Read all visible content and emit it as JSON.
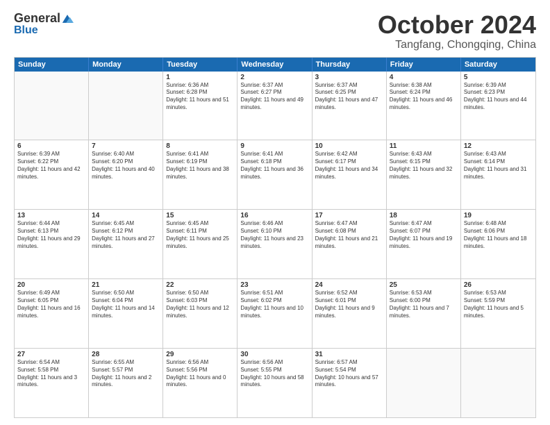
{
  "header": {
    "logo_general": "General",
    "logo_blue": "Blue",
    "month_title": "October 2024",
    "location": "Tangfang, Chongqing, China"
  },
  "weekdays": [
    "Sunday",
    "Monday",
    "Tuesday",
    "Wednesday",
    "Thursday",
    "Friday",
    "Saturday"
  ],
  "rows": [
    [
      {
        "day": "",
        "text": "",
        "empty": true
      },
      {
        "day": "",
        "text": "",
        "empty": true
      },
      {
        "day": "1",
        "text": "Sunrise: 6:36 AM\nSunset: 6:28 PM\nDaylight: 11 hours and 51 minutes."
      },
      {
        "day": "2",
        "text": "Sunrise: 6:37 AM\nSunset: 6:27 PM\nDaylight: 11 hours and 49 minutes."
      },
      {
        "day": "3",
        "text": "Sunrise: 6:37 AM\nSunset: 6:25 PM\nDaylight: 11 hours and 47 minutes."
      },
      {
        "day": "4",
        "text": "Sunrise: 6:38 AM\nSunset: 6:24 PM\nDaylight: 11 hours and 46 minutes."
      },
      {
        "day": "5",
        "text": "Sunrise: 6:39 AM\nSunset: 6:23 PM\nDaylight: 11 hours and 44 minutes."
      }
    ],
    [
      {
        "day": "6",
        "text": "Sunrise: 6:39 AM\nSunset: 6:22 PM\nDaylight: 11 hours and 42 minutes."
      },
      {
        "day": "7",
        "text": "Sunrise: 6:40 AM\nSunset: 6:20 PM\nDaylight: 11 hours and 40 minutes."
      },
      {
        "day": "8",
        "text": "Sunrise: 6:41 AM\nSunset: 6:19 PM\nDaylight: 11 hours and 38 minutes."
      },
      {
        "day": "9",
        "text": "Sunrise: 6:41 AM\nSunset: 6:18 PM\nDaylight: 11 hours and 36 minutes."
      },
      {
        "day": "10",
        "text": "Sunrise: 6:42 AM\nSunset: 6:17 PM\nDaylight: 11 hours and 34 minutes."
      },
      {
        "day": "11",
        "text": "Sunrise: 6:43 AM\nSunset: 6:15 PM\nDaylight: 11 hours and 32 minutes."
      },
      {
        "day": "12",
        "text": "Sunrise: 6:43 AM\nSunset: 6:14 PM\nDaylight: 11 hours and 31 minutes."
      }
    ],
    [
      {
        "day": "13",
        "text": "Sunrise: 6:44 AM\nSunset: 6:13 PM\nDaylight: 11 hours and 29 minutes."
      },
      {
        "day": "14",
        "text": "Sunrise: 6:45 AM\nSunset: 6:12 PM\nDaylight: 11 hours and 27 minutes."
      },
      {
        "day": "15",
        "text": "Sunrise: 6:45 AM\nSunset: 6:11 PM\nDaylight: 11 hours and 25 minutes."
      },
      {
        "day": "16",
        "text": "Sunrise: 6:46 AM\nSunset: 6:10 PM\nDaylight: 11 hours and 23 minutes."
      },
      {
        "day": "17",
        "text": "Sunrise: 6:47 AM\nSunset: 6:08 PM\nDaylight: 11 hours and 21 minutes."
      },
      {
        "day": "18",
        "text": "Sunrise: 6:47 AM\nSunset: 6:07 PM\nDaylight: 11 hours and 19 minutes."
      },
      {
        "day": "19",
        "text": "Sunrise: 6:48 AM\nSunset: 6:06 PM\nDaylight: 11 hours and 18 minutes."
      }
    ],
    [
      {
        "day": "20",
        "text": "Sunrise: 6:49 AM\nSunset: 6:05 PM\nDaylight: 11 hours and 16 minutes."
      },
      {
        "day": "21",
        "text": "Sunrise: 6:50 AM\nSunset: 6:04 PM\nDaylight: 11 hours and 14 minutes."
      },
      {
        "day": "22",
        "text": "Sunrise: 6:50 AM\nSunset: 6:03 PM\nDaylight: 11 hours and 12 minutes."
      },
      {
        "day": "23",
        "text": "Sunrise: 6:51 AM\nSunset: 6:02 PM\nDaylight: 11 hours and 10 minutes."
      },
      {
        "day": "24",
        "text": "Sunrise: 6:52 AM\nSunset: 6:01 PM\nDaylight: 11 hours and 9 minutes."
      },
      {
        "day": "25",
        "text": "Sunrise: 6:53 AM\nSunset: 6:00 PM\nDaylight: 11 hours and 7 minutes."
      },
      {
        "day": "26",
        "text": "Sunrise: 6:53 AM\nSunset: 5:59 PM\nDaylight: 11 hours and 5 minutes."
      }
    ],
    [
      {
        "day": "27",
        "text": "Sunrise: 6:54 AM\nSunset: 5:58 PM\nDaylight: 11 hours and 3 minutes."
      },
      {
        "day": "28",
        "text": "Sunrise: 6:55 AM\nSunset: 5:57 PM\nDaylight: 11 hours and 2 minutes."
      },
      {
        "day": "29",
        "text": "Sunrise: 6:56 AM\nSunset: 5:56 PM\nDaylight: 11 hours and 0 minutes."
      },
      {
        "day": "30",
        "text": "Sunrise: 6:56 AM\nSunset: 5:55 PM\nDaylight: 10 hours and 58 minutes."
      },
      {
        "day": "31",
        "text": "Sunrise: 6:57 AM\nSunset: 5:54 PM\nDaylight: 10 hours and 57 minutes."
      },
      {
        "day": "",
        "text": "",
        "empty": true
      },
      {
        "day": "",
        "text": "",
        "empty": true
      }
    ]
  ]
}
